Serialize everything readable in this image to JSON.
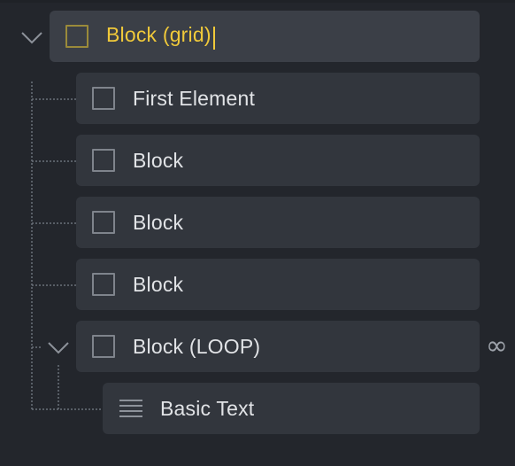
{
  "tree": {
    "root": {
      "label": "Block (grid)",
      "state": "editing"
    },
    "children": [
      {
        "label": "First Element"
      },
      {
        "label": "Block"
      },
      {
        "label": "Block"
      },
      {
        "label": "Block"
      },
      {
        "label": "Block (LOOP)",
        "badge": "∞"
      },
      {
        "label": "Basic Text"
      }
    ]
  },
  "icons": {
    "block": "square-block-icon",
    "text": "text-lines-icon",
    "loop": "infinity-loop-icon",
    "expand": "chevron-down-icon"
  },
  "colors": {
    "background": "#23262c",
    "row": "#32363d",
    "row_selected": "#3b3f47",
    "accent": "#f0c93a",
    "text": "#e1e3e6",
    "icon": "#7f848c"
  }
}
